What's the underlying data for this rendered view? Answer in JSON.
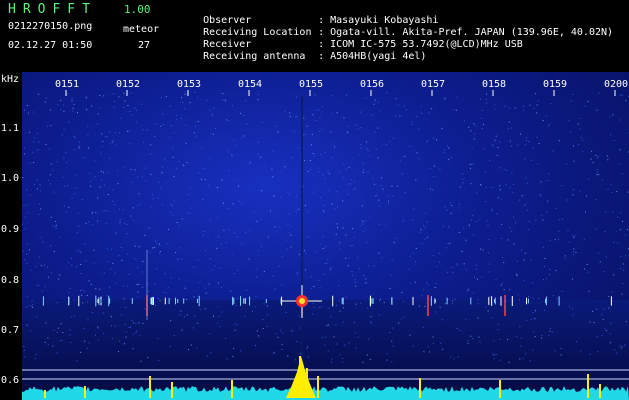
{
  "header": {
    "app_name": "HROFFT",
    "app_version": "1.00",
    "file_name": "0212270150.png",
    "meteor_label": "meteor",
    "timestamp": "02.12.27 01:50",
    "meteor_count": "27",
    "info": [
      {
        "key": "Observer",
        "sep": ":",
        "value": "Masayuki Kobayashi"
      },
      {
        "key": "Receiving Location",
        "sep": ":",
        "value": "Ogata-vill. Akita-Pref. JAPAN (139.96E, 40.02N)"
      },
      {
        "key": "Receiver",
        "sep": ":",
        "value": "ICOM IC-575 53.7492(@LCD)MHz USB"
      },
      {
        "key": "Receiving antenna",
        "sep": ":",
        "value": "A504HB(yagi 4el)"
      }
    ]
  },
  "spectrogram": {
    "y_unit": "kHz",
    "time_ticks": [
      "0151",
      "0152",
      "0153",
      "0154",
      "0155",
      "0156",
      "0157",
      "0158",
      "0159",
      "0200"
    ],
    "freq_ticks": [
      "1.1",
      "1.0",
      "0.9",
      "0.8",
      "0.7",
      "0.6"
    ]
  }
}
